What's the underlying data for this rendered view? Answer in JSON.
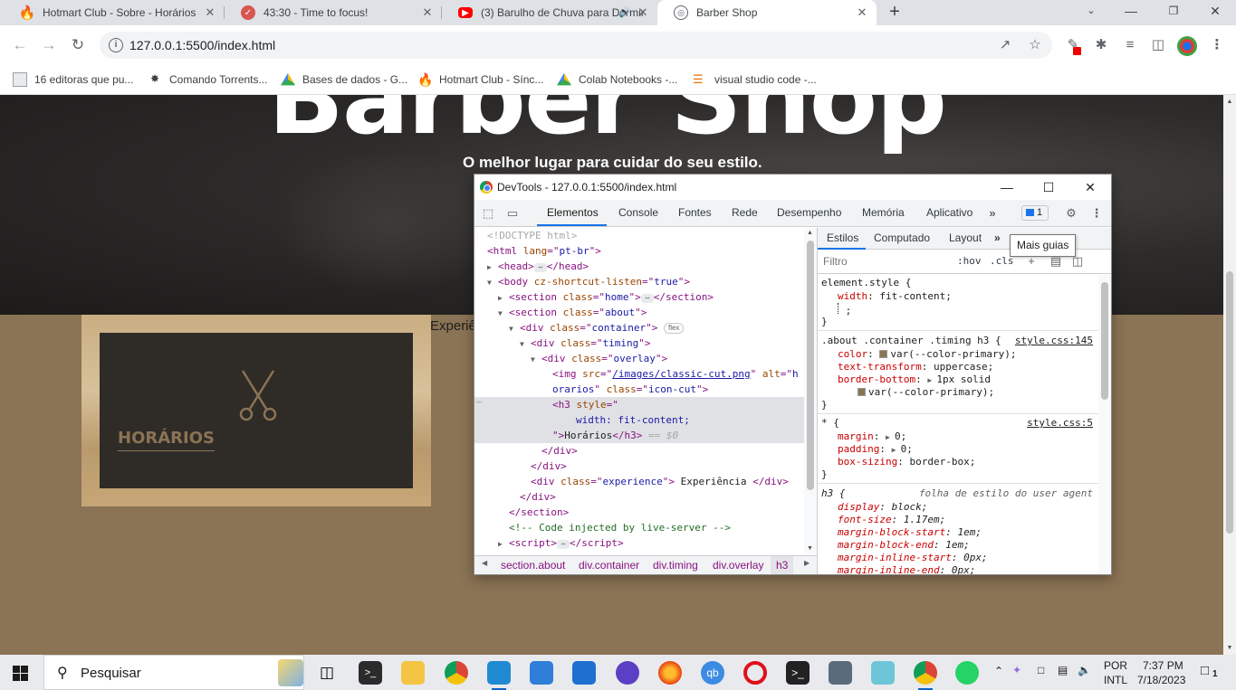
{
  "browser": {
    "tabs": [
      {
        "title": "Hotmart Club - Sobre - Horários",
        "icon": "hotmart-flame-icon",
        "color": "#f04e23"
      },
      {
        "title": "43:30 - Time to focus!",
        "icon": "pomodoro-check-icon",
        "color": "#d95550"
      },
      {
        "title": "(3) Barulho de Chuva para Dormir",
        "icon": "youtube-icon",
        "color": "#ff0000"
      },
      {
        "title": "Barber Shop",
        "icon": "globe-icon",
        "color": "#5f6368"
      }
    ],
    "url": "127.0.0.1:5500/index.html",
    "bookmarks": [
      "16 editoras que pu...",
      "Comando Torrents...",
      "Bases de dados - G...",
      "Hotmart Club - Sínc...",
      "Colab Notebooks -...",
      "visual studio code -..."
    ]
  },
  "page": {
    "hero_title": "Barber Shop",
    "hero_subtitle": "O melhor lugar para cuidar do seu estilo.",
    "timing_heading": "Horários",
    "experience_text": "Experiência",
    "colors": {
      "primary": "#8b7355",
      "overlay": "#2f2b27"
    }
  },
  "devtools": {
    "window_title": "DevTools - 127.0.0.1:5500/index.html",
    "tabs": [
      "Elementos",
      "Console",
      "Fontes",
      "Rede",
      "Desempenho",
      "Memória",
      "Aplicativo"
    ],
    "active_tab": "Elementos",
    "issues_count": "1",
    "breadcrumbs": [
      "section.about",
      "div.container",
      "div.timing",
      "div.overlay",
      "h3"
    ],
    "styles_tabs": [
      "Estilos",
      "Computado",
      "Layout"
    ],
    "filter_placeholder": "Filtro",
    "hov": ":hov",
    "cls": ".cls",
    "tooltip": "Mais guias",
    "dom": {
      "doctype": "<!DOCTYPE html>",
      "html_lang": "pt-br",
      "body_attr": "cz-shortcut-listen",
      "body_val": "true",
      "home_class": "home",
      "about_class": "about",
      "container_class": "container",
      "flex_badge": "flex",
      "timing_class": "timing",
      "overlay_class": "overlay",
      "img_src": "/images/classic-cut.png",
      "img_alt_1": "h",
      "img_alt_2": "orarios",
      "img_class": "icon-cut",
      "h3_style": "width: fit-content;",
      "h3_text": "Horários",
      "dollar0": "== $0",
      "experience_class": "experience",
      "experience_text": " Experiência ",
      "comment": "<!-- Code injected by live-server -->"
    },
    "rules": {
      "element_style": {
        "selector": "element.style {",
        "prop": "width",
        "value": "fit-content;"
      },
      "timing_h3": {
        "selector": ".about .container .timing h3 {",
        "source": "style.css:145",
        "color": "var(--color-primary);",
        "text_transform": "uppercase;",
        "border_bottom": "1px solid",
        "border_color": "var(--color-primary);"
      },
      "universal": {
        "selector": "* {",
        "source": "style.css:5",
        "margin": "0;",
        "padding": "0;",
        "box_sizing": "border-box;"
      },
      "ua_h3": {
        "selector": "h3 {",
        "source": "folha de estilo do user agent",
        "display": "block;",
        "font_size": "1.17em;",
        "mbs": "1em;",
        "mbe": "1em;",
        "mis": "0px;",
        "mie": "0px;"
      }
    }
  },
  "taskbar": {
    "search_placeholder": "Pesquisar",
    "lang_1": "POR",
    "lang_2": "INTL",
    "time": "7:37 PM",
    "date": "7/18/2023",
    "notif_count": "1"
  }
}
